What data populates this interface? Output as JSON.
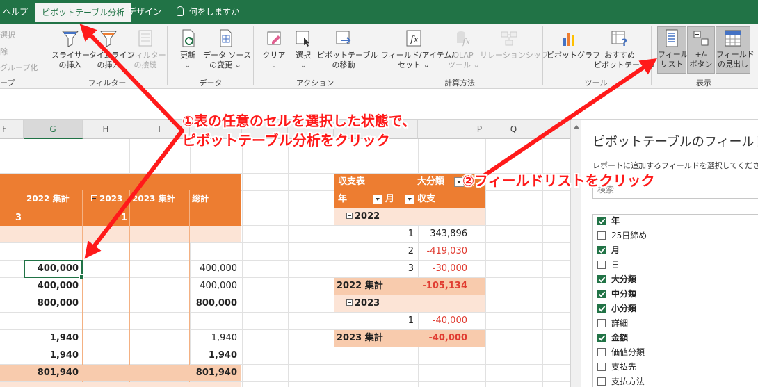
{
  "tabs": [
    {
      "label": "ヘルプ",
      "active": false
    },
    {
      "label": "ピボットテーブル分析",
      "active": true
    },
    {
      "label": "デザイン",
      "active": false
    },
    {
      "label": "何をしますか",
      "active": false
    }
  ],
  "ribbon": {
    "partial_group": {
      "items": [
        "選択",
        "除",
        "グループ化"
      ],
      "label": "ープ"
    },
    "filter": {
      "label": "フィルター",
      "buttons": [
        {
          "label1": "スライサー",
          "label2": "の挿入",
          "icon": "slicer-icon"
        },
        {
          "label1": "タイムライン",
          "label2": "の挿入",
          "icon": "timeline-icon"
        },
        {
          "label1": "フィルター",
          "label2": "の接続",
          "icon": "filter-connection-icon",
          "disabled": true
        }
      ]
    },
    "data": {
      "label": "データ",
      "buttons": [
        {
          "label1": "更新",
          "label2": "⌄",
          "icon": "refresh-icon"
        },
        {
          "label1": "データ ソース",
          "label2": "の変更 ⌄",
          "icon": "data-source-icon"
        }
      ]
    },
    "action": {
      "label": "アクション",
      "buttons": [
        {
          "label1": "クリア",
          "label2": "⌄",
          "icon": "clear-icon"
        },
        {
          "label1": "選択",
          "label2": "⌄",
          "icon": "select-icon"
        },
        {
          "label1": "ピボットテーブル",
          "label2": "の移動",
          "icon": "move-pivot-icon"
        }
      ]
    },
    "calc": {
      "label": "計算方法",
      "buttons": [
        {
          "label1": "フィールド/アイテム/",
          "label2": "セット ⌄",
          "icon": "fields-items-icon"
        },
        {
          "label1": "OLAP",
          "label2": "ツール ⌄",
          "icon": "olap-icon",
          "disabled": true
        },
        {
          "label1": "リレーションシップ",
          "label2": "",
          "icon": "relationships-icon",
          "disabled": true
        }
      ]
    },
    "tools": {
      "label": "ツール",
      "buttons": [
        {
          "label1": "ピボットグラフ",
          "label2": "",
          "icon": "pivot-chart-icon"
        },
        {
          "label1": "おすすめ",
          "label2": "ピボットテーブル",
          "icon": "recommended-pivot-icon"
        }
      ]
    },
    "show": {
      "label": "表示",
      "buttons": [
        {
          "label1": "フィールド",
          "label2": "リスト",
          "icon": "field-list-icon",
          "pressed": true
        },
        {
          "label1": "+/-",
          "label2": "ボタン",
          "icon": "plus-minus-icon",
          "pressed": true
        },
        {
          "label1": "フィールド",
          "label2": "の見出し",
          "icon": "field-headers-icon",
          "pressed": true
        }
      ]
    }
  },
  "columns": [
    "F",
    "G",
    "H",
    "I",
    "",
    "",
    "",
    "",
    "P",
    "Q"
  ],
  "selected_column": "G",
  "left_pivot": {
    "partial_label_a": "3",
    "partial_label_b": "1",
    "header_2022": "2022 集計",
    "header_2023_collapsed": "2023",
    "header_2023": "2023 集計",
    "header_total": "総計",
    "rows": [
      {
        "g": "400,000",
        "total": "400,000",
        "bold_g": true,
        "bold_total": false,
        "selected": true
      },
      {
        "g": "400,000",
        "total": "400,000",
        "bold_g": true,
        "bold_total": false
      },
      {
        "g": "800,000",
        "total": "800,000",
        "bold_g": true,
        "bold_total": true
      },
      {
        "g": "1,940",
        "total": "1,940",
        "bold_g": true,
        "bold_total": false
      },
      {
        "g": "1,940",
        "total": "1,940",
        "bold_g": true,
        "bold_total": true
      }
    ],
    "grand_total": {
      "g": "801,940",
      "total": "801,940"
    }
  },
  "right_pivot": {
    "header": {
      "row_label": "収支表",
      "col_label": "大分類",
      "year": "年",
      "month": "月",
      "col_value": "収支"
    },
    "group_2022": "2022",
    "rows_2022": [
      {
        "month": "1",
        "value": "343,896",
        "negative": false
      },
      {
        "month": "2",
        "value": "-419,030",
        "negative": true
      },
      {
        "month": "3",
        "value": "-30,000",
        "negative": true
      }
    ],
    "total_2022": {
      "label": "2022 集計",
      "value": "-105,134"
    },
    "group_2023": "2023",
    "rows_2023": [
      {
        "month": "1",
        "value": "-40,000",
        "negative": true
      }
    ],
    "total_2023": {
      "label": "2023 集計",
      "value": "-40,000"
    }
  },
  "field_pane": {
    "title": "ピボットテーブルのフィールド",
    "subtitle": "レポートに追加するフィールドを選択してください:",
    "search_placeholder": "検索",
    "fields": [
      {
        "label": "年",
        "checked": true
      },
      {
        "label": "25日締め",
        "checked": false
      },
      {
        "label": "月",
        "checked": true
      },
      {
        "label": "日",
        "checked": false
      },
      {
        "label": "大分類",
        "checked": true
      },
      {
        "label": "中分類",
        "checked": true
      },
      {
        "label": "小分類",
        "checked": true
      },
      {
        "label": "詳細",
        "checked": false
      },
      {
        "label": "金額",
        "checked": true
      },
      {
        "label": "価値分類",
        "checked": false
      },
      {
        "label": "支払先",
        "checked": false
      },
      {
        "label": "支払方法",
        "checked": false
      }
    ]
  },
  "annotations": {
    "step1_line1": "①表の任意のセルを選択した状態で、",
    "step1_line2": "ピボットテーブル分析をクリック",
    "step2": "②フィールドリストをクリック"
  },
  "colors": {
    "excel_green": "#217346",
    "pivot_orange": "#ed7d31",
    "band_light": "#fce4d6",
    "band_mid": "#f8cbad",
    "annotation_red": "#ff1a1a",
    "negative_red": "#e03c31"
  }
}
